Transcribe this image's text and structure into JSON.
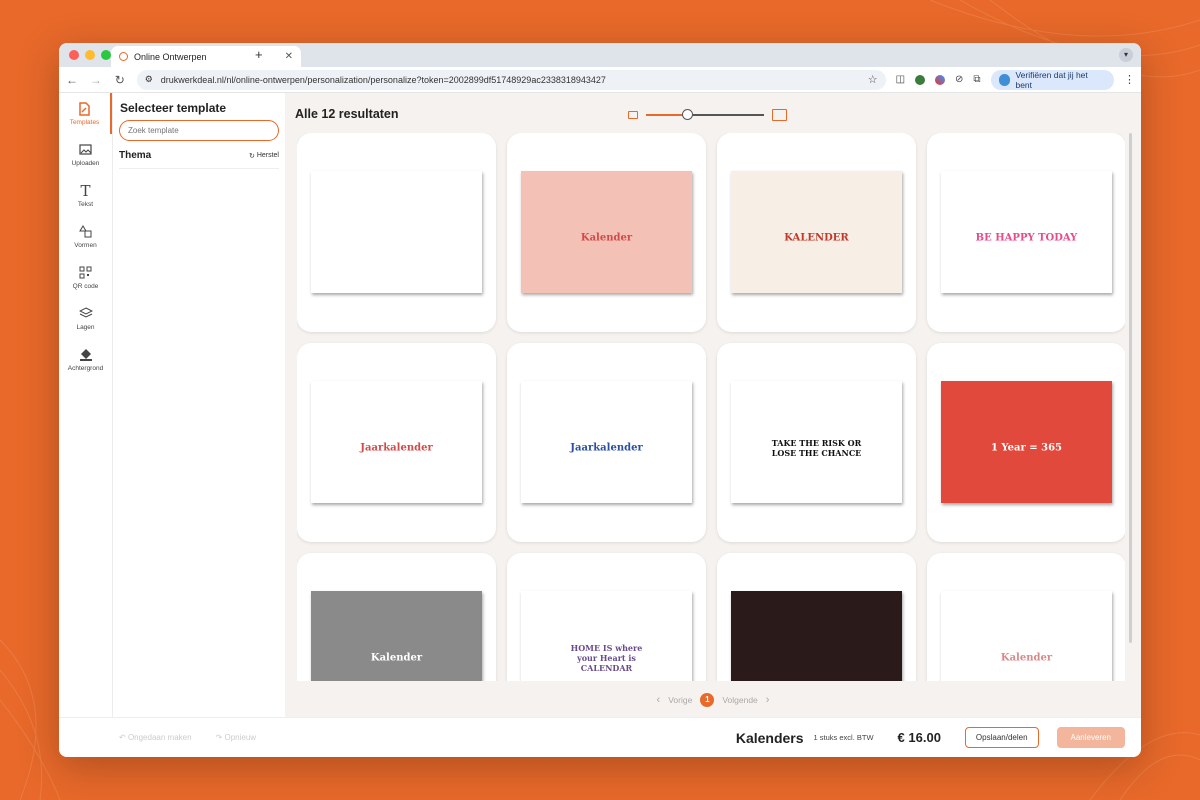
{
  "browser": {
    "tab_title": "Online Ontwerpen",
    "new_tab": "+",
    "url": "drukwerkdeal.nl/nl/online-ontwerpen/personalization/personalize?token=2002899df51748929ac2338318943427",
    "verify_label": "Verifiëren dat jij het bent"
  },
  "rail": {
    "items": [
      {
        "label": "Templates",
        "icon": "template-icon"
      },
      {
        "label": "Uploaden",
        "icon": "image-icon"
      },
      {
        "label": "Tekst",
        "icon": "text-icon"
      },
      {
        "label": "Vormen",
        "icon": "shapes-icon"
      },
      {
        "label": "QR code",
        "icon": "qr-icon"
      },
      {
        "label": "Lagen",
        "icon": "layers-icon"
      },
      {
        "label": "Achtergrond",
        "icon": "paint-bucket-icon"
      }
    ]
  },
  "panel": {
    "title": "Selecteer template",
    "search_placeholder": "Zoek template",
    "theme_heading": "Thema",
    "reset_label": "Herstel"
  },
  "main": {
    "results_title": "Alle 12 resultaten",
    "zoom_level": 0.35,
    "templates": [
      {
        "bg": "#ffffff",
        "label": "",
        "label_color": "#000"
      },
      {
        "bg": "#f4c1b6",
        "label": "Kalender",
        "label_color": "#d04a4a"
      },
      {
        "bg": "#f7efe6",
        "label": "KALENDER",
        "label_color": "#c0392b"
      },
      {
        "bg": "#ffffff",
        "label": "BE HAPPY TODAY",
        "label_color": "#e84a8a"
      },
      {
        "bg": "#ffffff",
        "label": "Jaarkalender",
        "label_color": "#d04a4a"
      },
      {
        "bg": "#ffffff",
        "label": "Jaarkalender",
        "label_color": "#2a4fa0"
      },
      {
        "bg": "#ffffff",
        "label": "TAKE THE RISK OR LOSE THE CHANCE",
        "label_color": "#111"
      },
      {
        "bg": "#e0493c",
        "label": "1 Year = 365",
        "label_color": "#ffffff"
      },
      {
        "bg": "#8a8a8a",
        "label": "Kalender",
        "label_color": "#ffffff"
      },
      {
        "bg": "#ffffff",
        "label": "HOME IS where your Heart is CALENDAR",
        "label_color": "#6a4c8c"
      },
      {
        "bg": "#2a1a1a",
        "label": "",
        "label_color": "#fff"
      },
      {
        "bg": "#ffffff",
        "label": "Kalender",
        "label_color": "#d88a8a"
      }
    ]
  },
  "pagination": {
    "prev": "Vorige",
    "current": "1",
    "next": "Volgende"
  },
  "footer": {
    "undo": "Ongedaan maken",
    "redo": "Opnieuw",
    "product": "Kalenders",
    "quantity": "1 stuks excl. BTW",
    "price": "€ 16.00",
    "save": "Opslaan/delen",
    "deliver": "Aanleveren"
  },
  "colors": {
    "accent": "#e8692a"
  }
}
